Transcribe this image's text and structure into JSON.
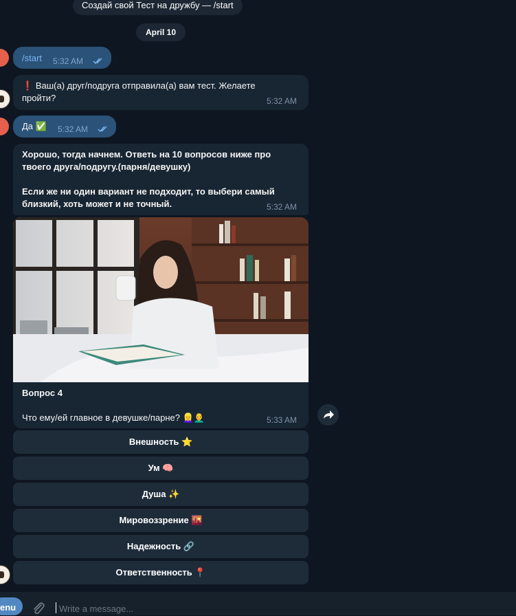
{
  "top_pill": "Создай свой Тест на дружбу — /start",
  "date_pill": "April 10",
  "messages": {
    "m1": {
      "text": "/start",
      "time": "5:32 AM"
    },
    "m2": {
      "icon": "❗",
      "text": "Ваш(а) друг/подруга отправила(а) вам тест. Желаете пройти?",
      "time": "5:32 AM"
    },
    "m3": {
      "text": "Да ✅",
      "time": "5:32 AM"
    },
    "m4": {
      "line1": "Хорошо, тогда начнем. Ответь на 10 вопросов ниже про твоего друга/подругу.(парня/девушку)",
      "line2": "Если же ни один вариант не подходит, то выбери самый близкий, хоть может и не точный.",
      "time": "5:32 AM"
    },
    "m5": {
      "title": "Вопрос 4",
      "question": "Что ему/ей главное в девушке/парне? 👱‍♀️👨‍🦲",
      "time": "5:33 AM"
    }
  },
  "buttons": [
    "Внешность ⭐",
    "Ум 🧠",
    "Душа ✨",
    "Мировоззрение 🌇",
    "Надежность 🔗",
    "Ответственность 📍"
  ],
  "input": {
    "menu_label": "enu",
    "placeholder": "Write a message..."
  },
  "colors": {
    "background": "#0e1621",
    "incoming": "#182533",
    "outgoing": "#2b5278",
    "button": "#1e2c3a",
    "accent": "#5288c1"
  }
}
